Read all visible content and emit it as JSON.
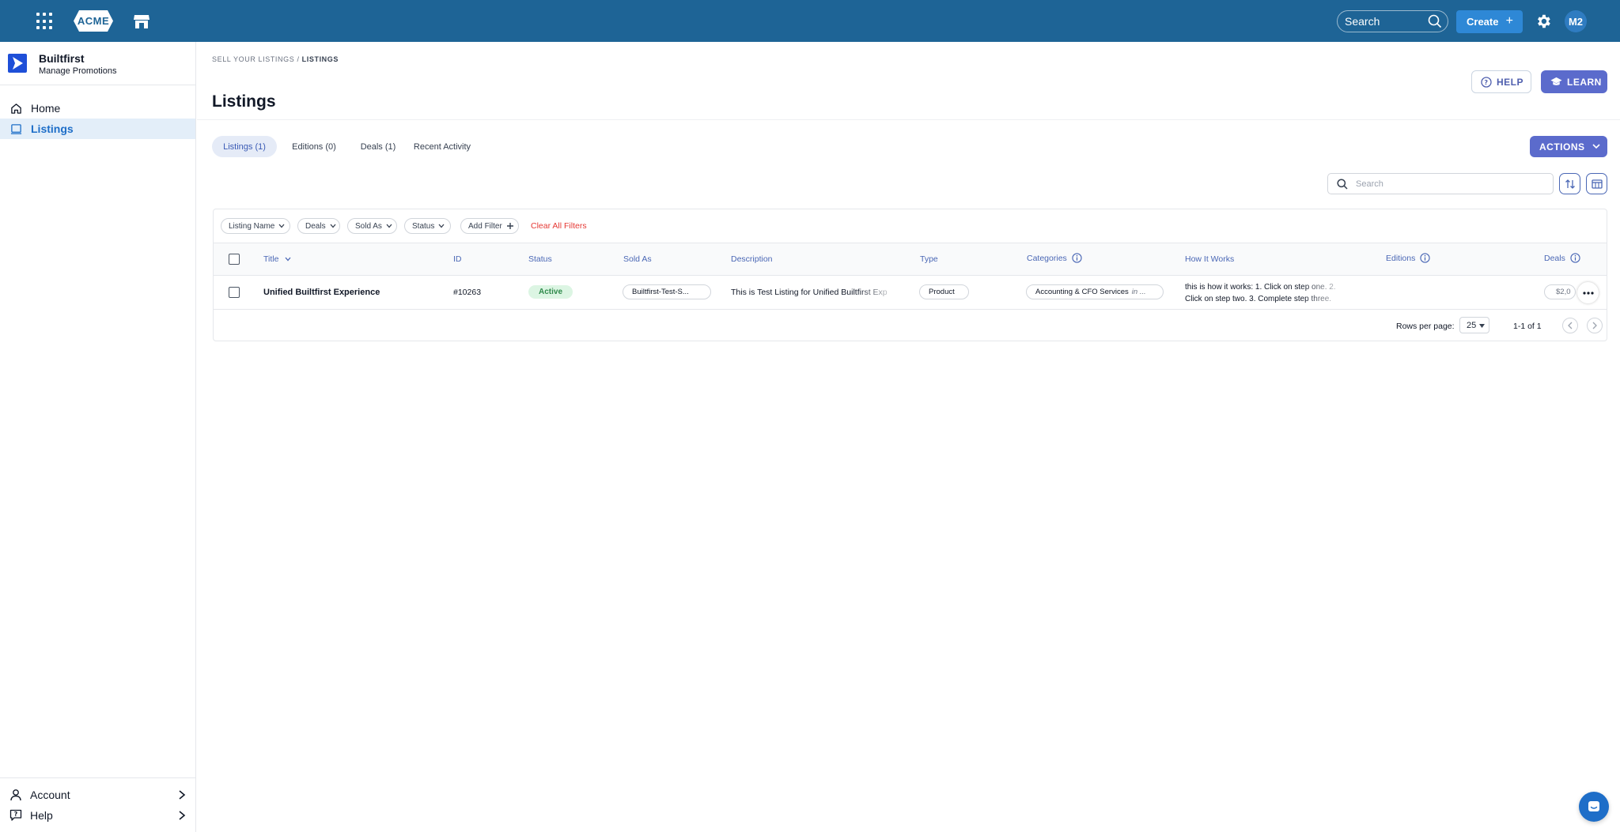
{
  "topbar": {
    "logo_text": "ACME",
    "search_label": "Search",
    "create_label": "Create",
    "avatar_initials": "M2",
    "bar_color": "#1e6496"
  },
  "sidebar": {
    "brand_name": "Builtfirst",
    "brand_subtitle": "Manage Promotions",
    "items": [
      {
        "label": "Home",
        "icon": "home-icon",
        "active": false
      },
      {
        "label": "Listings",
        "icon": "listings-icon",
        "active": true
      }
    ],
    "bottom_items": [
      {
        "label": "Account",
        "icon": "user-icon"
      },
      {
        "label": "Help",
        "icon": "help-icon"
      }
    ]
  },
  "breadcrumb": {
    "parent": "SELL YOUR LISTINGS",
    "separator": "/",
    "current": "LISTINGS"
  },
  "page": {
    "title": "Listings",
    "help_label": "HELP",
    "learn_label": "LEARN",
    "actions_label": "ACTIONS"
  },
  "tabs": [
    {
      "label": "Listings (1)",
      "active": true
    },
    {
      "label": "Editions (0)",
      "active": false
    },
    {
      "label": "Deals (1)",
      "active": false
    },
    {
      "label": "Recent Activity",
      "active": false
    }
  ],
  "table_search": {
    "placeholder": "Search"
  },
  "filters": {
    "chips": [
      "Listing Name",
      "Deals",
      "Sold As",
      "Status",
      "Add Filter"
    ],
    "clear_label": "Clear All Filters"
  },
  "table": {
    "columns": [
      "Title",
      "ID",
      "Status",
      "Sold As",
      "Description",
      "Type",
      "Categories",
      "How It Works",
      "Editions",
      "Deals"
    ],
    "rows": [
      {
        "title": "Unified Builtfirst Experience",
        "id": "#10263",
        "status": "Active",
        "sold_as": "Builtfirst-Test-S...",
        "description": "This is Test Listing for Unified Builtfirst Exp",
        "type": "Product",
        "categories": "Accounting & CFO Services",
        "categories_suffix": "in ...",
        "how_it_works_line1": "this is how it works: 1. Click on step one. 2.",
        "how_it_works_line2": "Click on step two. 3. Complete step three.",
        "deals": "$2,0"
      }
    ]
  },
  "pagination": {
    "rows_per_page_label": "Rows per page:",
    "rows_per_page_value": "25",
    "range": "1-1 of 1"
  },
  "colors": {
    "accent": "#5b6bcc",
    "link": "#4a67b5",
    "active_badge_bg": "#dcf5e3",
    "active_badge_text": "#2f8a4b",
    "clear_filters": "#e53935"
  }
}
